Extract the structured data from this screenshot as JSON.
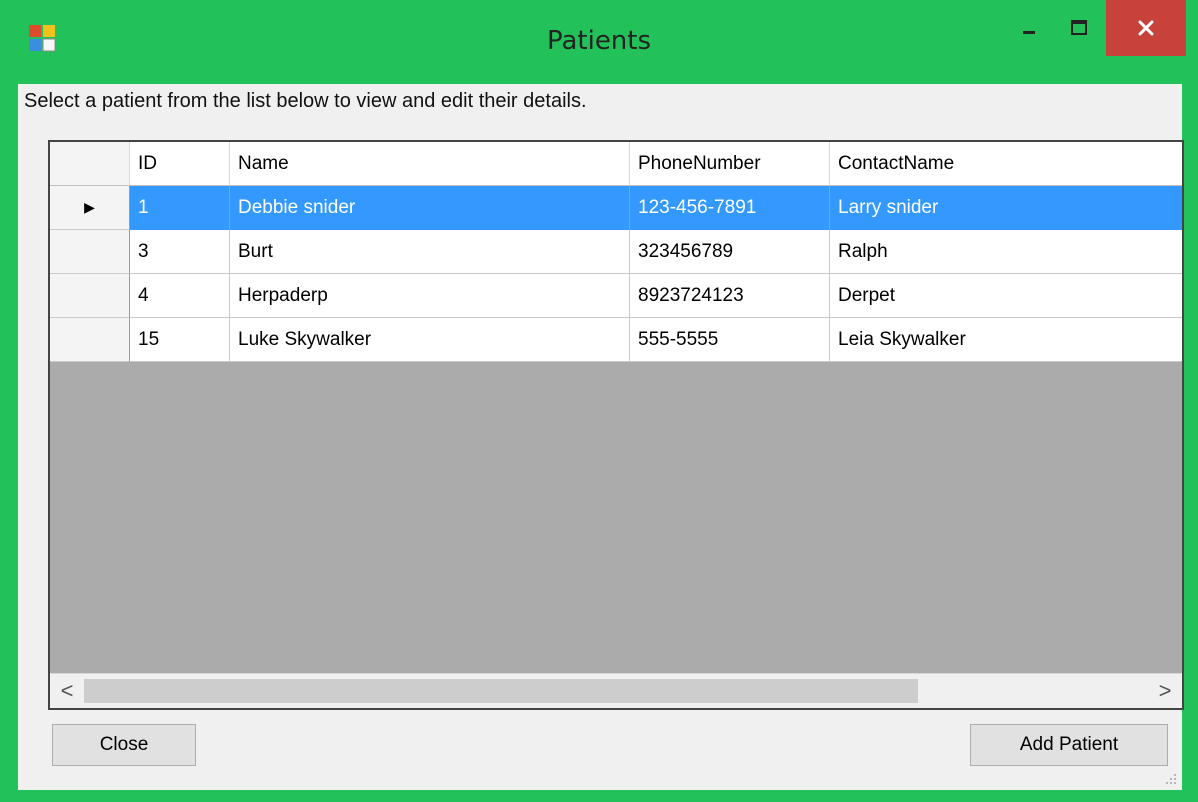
{
  "window": {
    "title": "Patients",
    "instruction": "Select a patient from the list below to view and edit their details."
  },
  "grid": {
    "columns": [
      "ID",
      "Name",
      "PhoneNumber",
      "ContactName"
    ],
    "rows": [
      {
        "id": "1",
        "name": "Debbie snider",
        "phone": "123-456-7891",
        "contact": "Larry snider",
        "selected": true
      },
      {
        "id": "3",
        "name": "Burt",
        "phone": "323456789",
        "contact": "Ralph",
        "selected": false
      },
      {
        "id": "4",
        "name": "Herpaderp",
        "phone": "8923724123",
        "contact": "Derpet",
        "selected": false
      },
      {
        "id": "15",
        "name": "Luke Skywalker",
        "phone": "555-5555",
        "contact": "Leia Skywalker",
        "selected": false
      }
    ],
    "scroll_left_glyph": "<",
    "scroll_right_glyph": ">",
    "row_indicator_glyph": "▶"
  },
  "buttons": {
    "close_label": "Close",
    "add_label": "Add Patient"
  },
  "colors": {
    "window_frame": "#22c15a",
    "selection": "#3399ff",
    "close_button": "#c7423b",
    "grid_empty_area": "#ababab"
  },
  "icons": {
    "app": "app-icon",
    "minimize": "minimize-icon",
    "maximize": "maximize-icon",
    "close": "close-icon",
    "row_indicator": "row-indicator-icon",
    "scroll_left": "scroll-left-icon",
    "scroll_right": "scroll-right-icon",
    "size_grip": "size-grip-icon"
  }
}
